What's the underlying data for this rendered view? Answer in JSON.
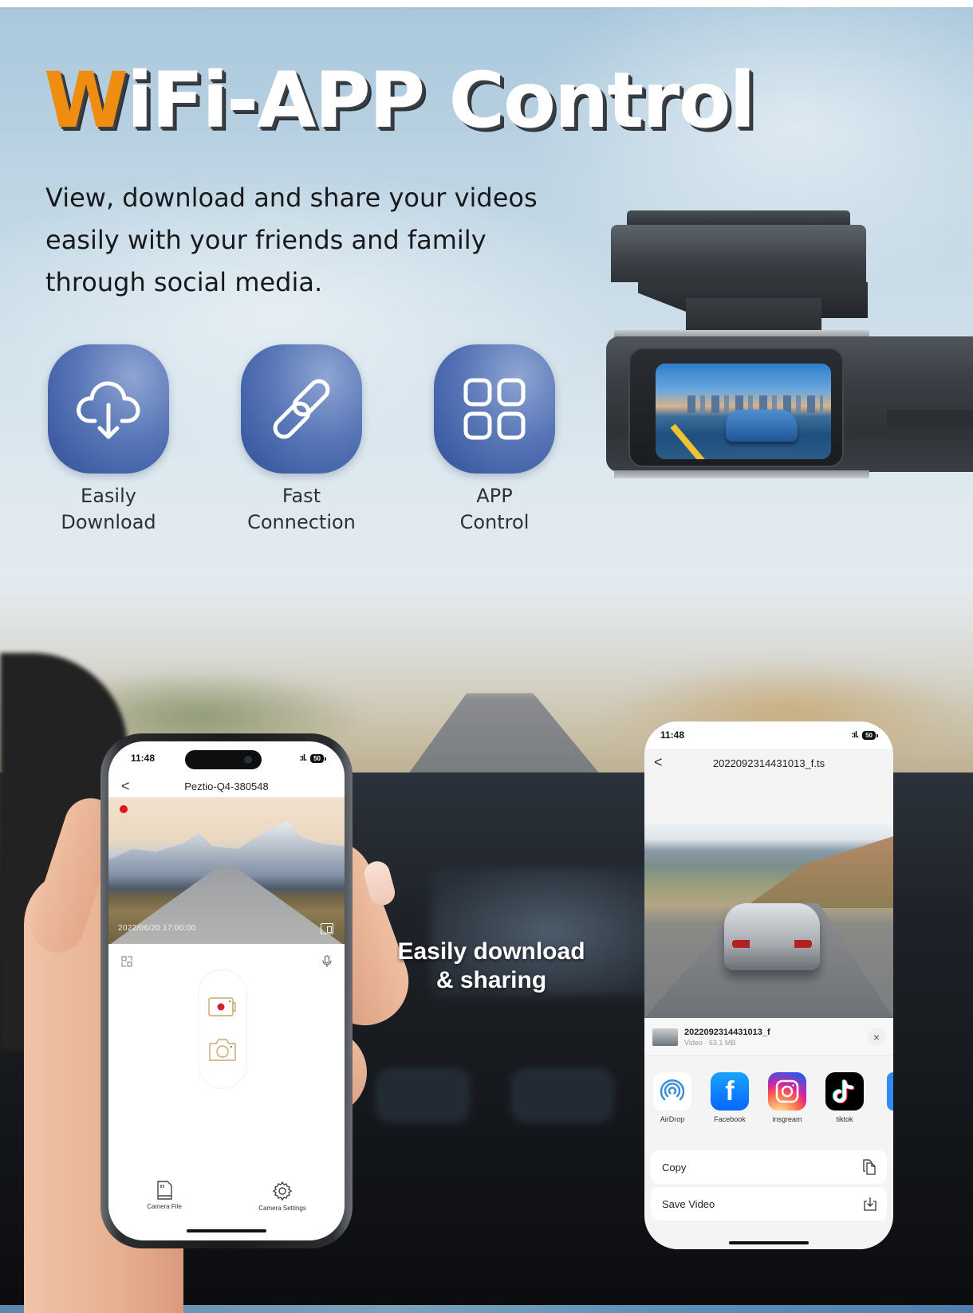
{
  "headline": {
    "accent_letter": "W",
    "rest": "iFi-APP Control"
  },
  "subtitle": [
    "View, download and share your videos",
    "easily with your friends and family",
    "through social media."
  ],
  "features": [
    {
      "icon": "cloud-download-icon",
      "line1": "Easily",
      "line2": "Download"
    },
    {
      "icon": "link-icon",
      "line1": "Fast",
      "line2": "Connection"
    },
    {
      "icon": "app-grid-icon",
      "line1": "APP",
      "line2": "Control"
    }
  ],
  "colors": {
    "accent_orange": "#f08c10",
    "tile_blue": "#4a67ab",
    "record_red": "#e0141e"
  },
  "caption": {
    "line1": "Easily download",
    "line2": "& sharing"
  },
  "left_phone": {
    "time": "11:48",
    "signal": ":ıl.",
    "battery": "50",
    "device_name": "Peztio-Q4-380548",
    "back": "<",
    "timestamp": "2022/06/20  17:00:00",
    "tabs": [
      {
        "icon": "sd-card-icon",
        "label": "Camera File"
      },
      {
        "icon": "gear-icon",
        "label": "Camera Settings"
      }
    ]
  },
  "right_phone": {
    "time": "11:48",
    "signal": ":ıl.",
    "battery": "50",
    "back": "<",
    "file_title": "2022092314431013_f.ts",
    "share_file_name": "2022092314431013_f",
    "share_file_meta": "Video · 63.1 MB",
    "close": "×",
    "apps": [
      {
        "icon": "airdrop-icon",
        "label": "AirDrop"
      },
      {
        "icon": "facebook-icon",
        "label": "Facebook"
      },
      {
        "icon": "instagram-icon",
        "label": "insgream"
      },
      {
        "icon": "tiktok-icon",
        "label": "tiktok"
      }
    ],
    "actions": [
      {
        "icon": "copy-icon",
        "label": "Copy"
      },
      {
        "icon": "save-icon",
        "label": "Save Video"
      }
    ]
  }
}
